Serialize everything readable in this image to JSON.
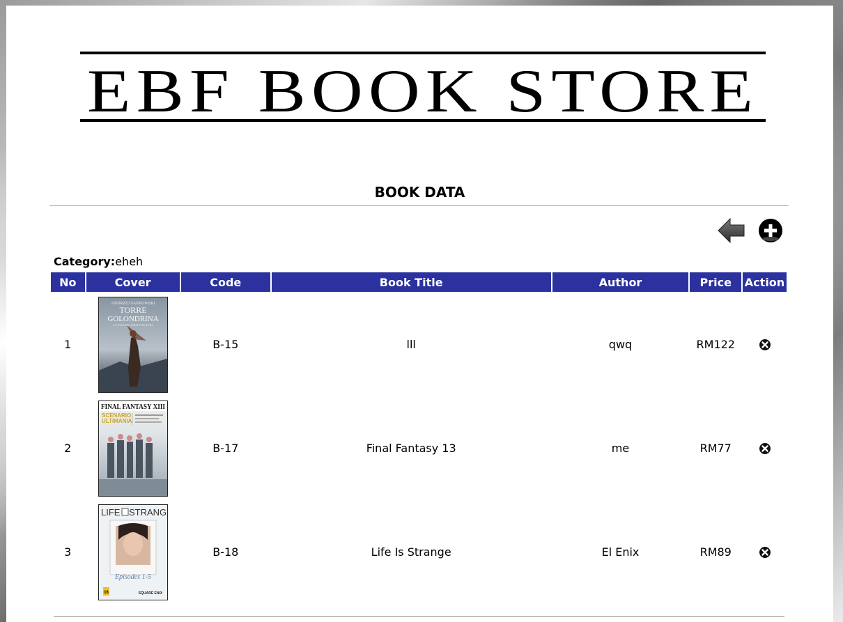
{
  "store": {
    "title": "EBF BOOK STORE"
  },
  "page": {
    "heading": "BOOK DATA"
  },
  "category": {
    "label": "Category:",
    "value": "eheh"
  },
  "table": {
    "headers": [
      "No",
      "Cover",
      "Code",
      "Book Title",
      "Author",
      "Price",
      "Action"
    ],
    "rows": [
      {
        "no": "1",
        "code": "B-15",
        "title": "lll",
        "author": "qwq",
        "price": "RM122",
        "cover": {
          "line1": "ANDRZEJ SAPKOWSKI",
          "line2": "TORRE",
          "line3": "GOLONDRINA",
          "line4": "LA SAGA DE GERALT DE RIVIA"
        }
      },
      {
        "no": "2",
        "code": "B-17",
        "title": "Final Fantasy 13",
        "author": "me",
        "price": "RM77",
        "cover": {
          "line1": "FINAL FANTASY XIII",
          "line2": "SCENARIO",
          "line3": "ULTIMANIA"
        }
      },
      {
        "no": "3",
        "code": "B-18",
        "title": "Life Is Strange",
        "author": "El Enix",
        "price": "RM89",
        "cover": {
          "line1": "LIFE",
          "line2": "STRANGE",
          "line3": "Episodes 1-5",
          "line4": "SQUARE ENIX",
          "line5": "16"
        }
      }
    ]
  },
  "icons": {
    "back": "arrow-left-icon",
    "add": "plus-circle-icon",
    "delete": "x-circle-icon"
  },
  "colors": {
    "header_bg": "#2b32a0",
    "header_text": "#ffffff"
  }
}
